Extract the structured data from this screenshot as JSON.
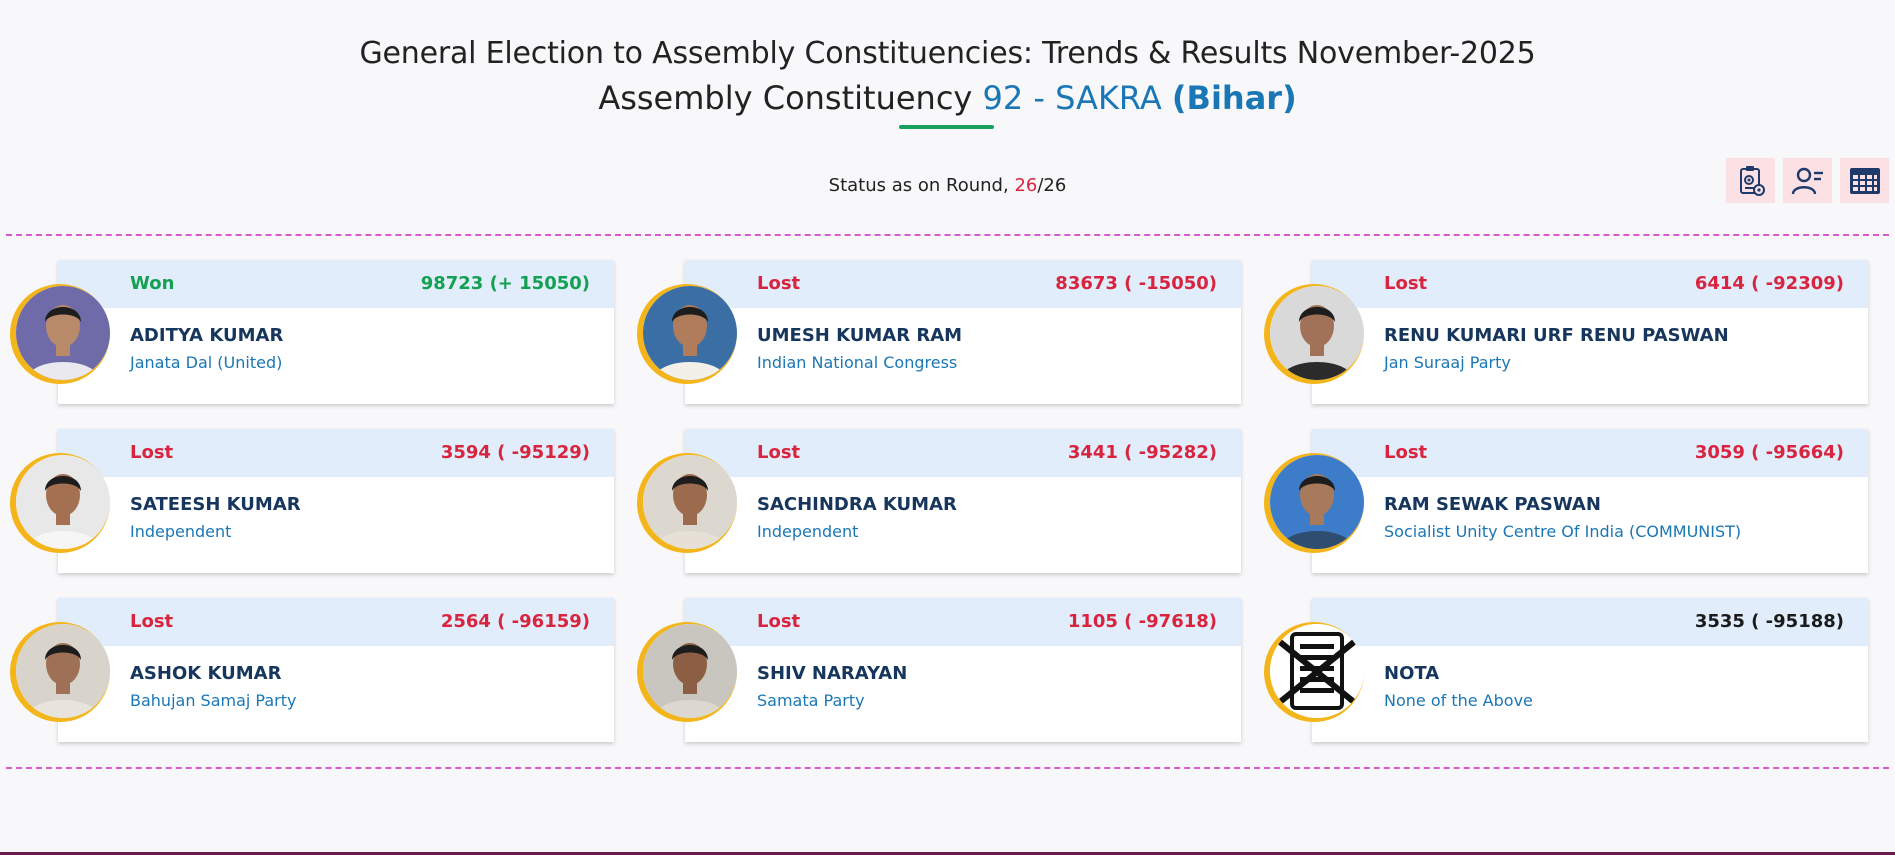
{
  "header": {
    "title_line1": "General Election to Assembly Constituencies: Trends & Results November-2025",
    "title_prefix": "Assembly Constituency",
    "constituency": "92 - SAKRA",
    "state": "(Bihar)"
  },
  "status": {
    "label": "Status as on Round,",
    "current_round": "26",
    "separator": "/",
    "total_rounds": "26"
  },
  "toolbar": {
    "buttons": [
      {
        "icon": "clipboard-gear-icon"
      },
      {
        "icon": "user-list-icon"
      },
      {
        "icon": "table-grid-icon"
      }
    ]
  },
  "colors": {
    "won": "#14a052",
    "lost": "#d8243e",
    "name": "#16365d",
    "party": "#1a77b5",
    "ring": "#f4b51a",
    "dash": "#d95ad0"
  },
  "candidates": [
    {
      "status": "Won",
      "votes": "98723 (+ 15050)",
      "name": "ADITYA KUMAR",
      "party": "Janata Dal (United)",
      "photo_bg": "#6f6aa8",
      "skin": "#b98a6a",
      "cloth": "#e9e9ef"
    },
    {
      "status": "Lost",
      "votes": "83673 ( -15050)",
      "name": "UMESH KUMAR RAM",
      "party": "Indian National Congress",
      "photo_bg": "#3a6ea5",
      "skin": "#b07c5c",
      "cloth": "#f3f0ea"
    },
    {
      "status": "Lost",
      "votes": "6414 ( -92309)",
      "name": "RENU KUMARI URF RENU PASWAN",
      "party": "Jan Suraaj Party",
      "photo_bg": "#d9d9d9",
      "skin": "#a27258",
      "cloth": "#2b2b2b"
    },
    {
      "status": "Lost",
      "votes": "3594 ( -95129)",
      "name": "SATEESH KUMAR",
      "party": "Independent",
      "photo_bg": "#e8e8e8",
      "skin": "#a37052",
      "cloth": "#f6f6f6"
    },
    {
      "status": "Lost",
      "votes": "3441 ( -95282)",
      "name": "SACHINDRA KUMAR",
      "party": "Independent",
      "photo_bg": "#dcd8d0",
      "skin": "#9c6a4c",
      "cloth": "#e6e0d6"
    },
    {
      "status": "Lost",
      "votes": "3059 ( -95664)",
      "name": "RAM SEWAK PASWAN",
      "party": "Socialist Unity Centre Of India (COMMUNIST)",
      "photo_bg": "#3d7cc9",
      "skin": "#a87a5c",
      "cloth": "#2f4d6e"
    },
    {
      "status": "Lost",
      "votes": "2564 ( -96159)",
      "name": "ASHOK KUMAR",
      "party": "Bahujan Samaj Party",
      "photo_bg": "#d8d4cc",
      "skin": "#9e7055",
      "cloth": "#e8e4dc"
    },
    {
      "status": "Lost",
      "votes": "1105 ( -97618)",
      "name": "SHIV NARAYAN",
      "party": "Samata Party",
      "photo_bg": "#c9c6bf",
      "skin": "#8c5e44",
      "cloth": "#ddd8cf"
    },
    {
      "status": "",
      "votes": "3535 ( -95188)",
      "name": "NOTA",
      "party": "None of the Above",
      "photo_bg": "#ffffff",
      "skin": "",
      "cloth": "",
      "nota": true
    }
  ]
}
